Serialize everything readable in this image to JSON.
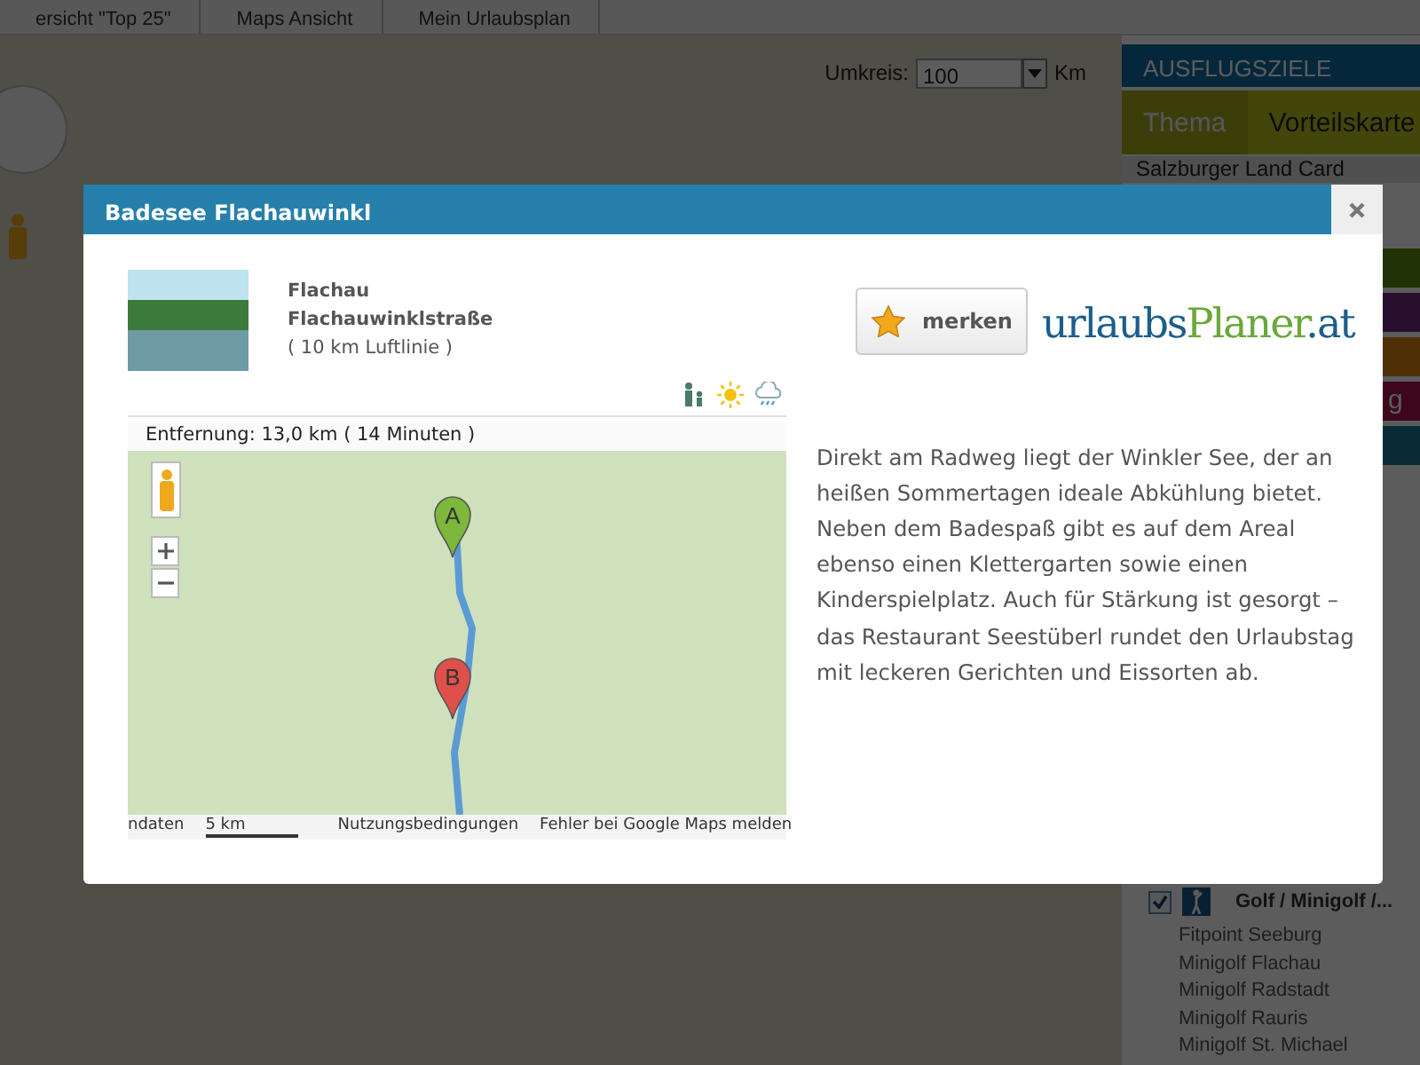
{
  "top_tabs": [
    {
      "label": "ersicht \"Top 25\""
    },
    {
      "label": "Maps Ansicht"
    },
    {
      "label": "Mein Urlaubsplan"
    }
  ],
  "radius_filter": {
    "label": "Umkreis:",
    "value": "100",
    "unit": "Km"
  },
  "sidebar": {
    "title": "AUSFLUGSZIELE",
    "tabs": [
      {
        "label": "Thema",
        "selected": true
      },
      {
        "label": "Vorteilskarte",
        "selected": false
      }
    ],
    "card_row": "Salzburger Land Card",
    "category_bars": [
      {
        "kind": "plain"
      },
      {
        "kind": "plain"
      },
      {
        "kind": "plain"
      },
      {
        "kind": "labelled",
        "label": "g"
      },
      {
        "kind": "plain"
      }
    ],
    "category": {
      "checked": true,
      "label": "Golf / Minigolf /...",
      "items": [
        "Fitpoint Seeburg",
        "Minigolf Flachau",
        "Minigolf Radstadt",
        "Minigolf Rauris",
        "Minigolf St. Michael"
      ]
    }
  },
  "dialog": {
    "title": "Badesee Flachauwinkl",
    "address": [
      "Flachau",
      "Flachauwinklstraße"
    ],
    "distance": "( 10 km Luftlinie )",
    "save_button": "merken",
    "logo": [
      {
        "text": "urlaubs",
        "color": "#1b5e8c"
      },
      {
        "text": "Planer",
        "color": "#6aa83a"
      },
      {
        "text": ".at",
        "color": "#1b5e8c"
      }
    ],
    "route_map": {
      "summary": "Entfernung: 13,0 km ( 14 Minuten )",
      "markers": [
        "A",
        "B"
      ],
      "footer": [
        "ndaten",
        "5 km",
        "Nutzungsbedingungen",
        "Fehler bei Google Maps melden"
      ]
    },
    "description": "Direkt am Radweg liegt der Winkler See, der an heißen Sommertagen ideale Abkühlung bietet. Neben dem Badespaß gibt es auf dem Areal ebenso einen Klettergarten sowie einen Kinderspielplatz. Auch für Stärkung ist gesorgt – das Restaurant Seestüberl rundet den Urlaubstag mit leckeren Gerichten und Eissorten ab."
  }
}
